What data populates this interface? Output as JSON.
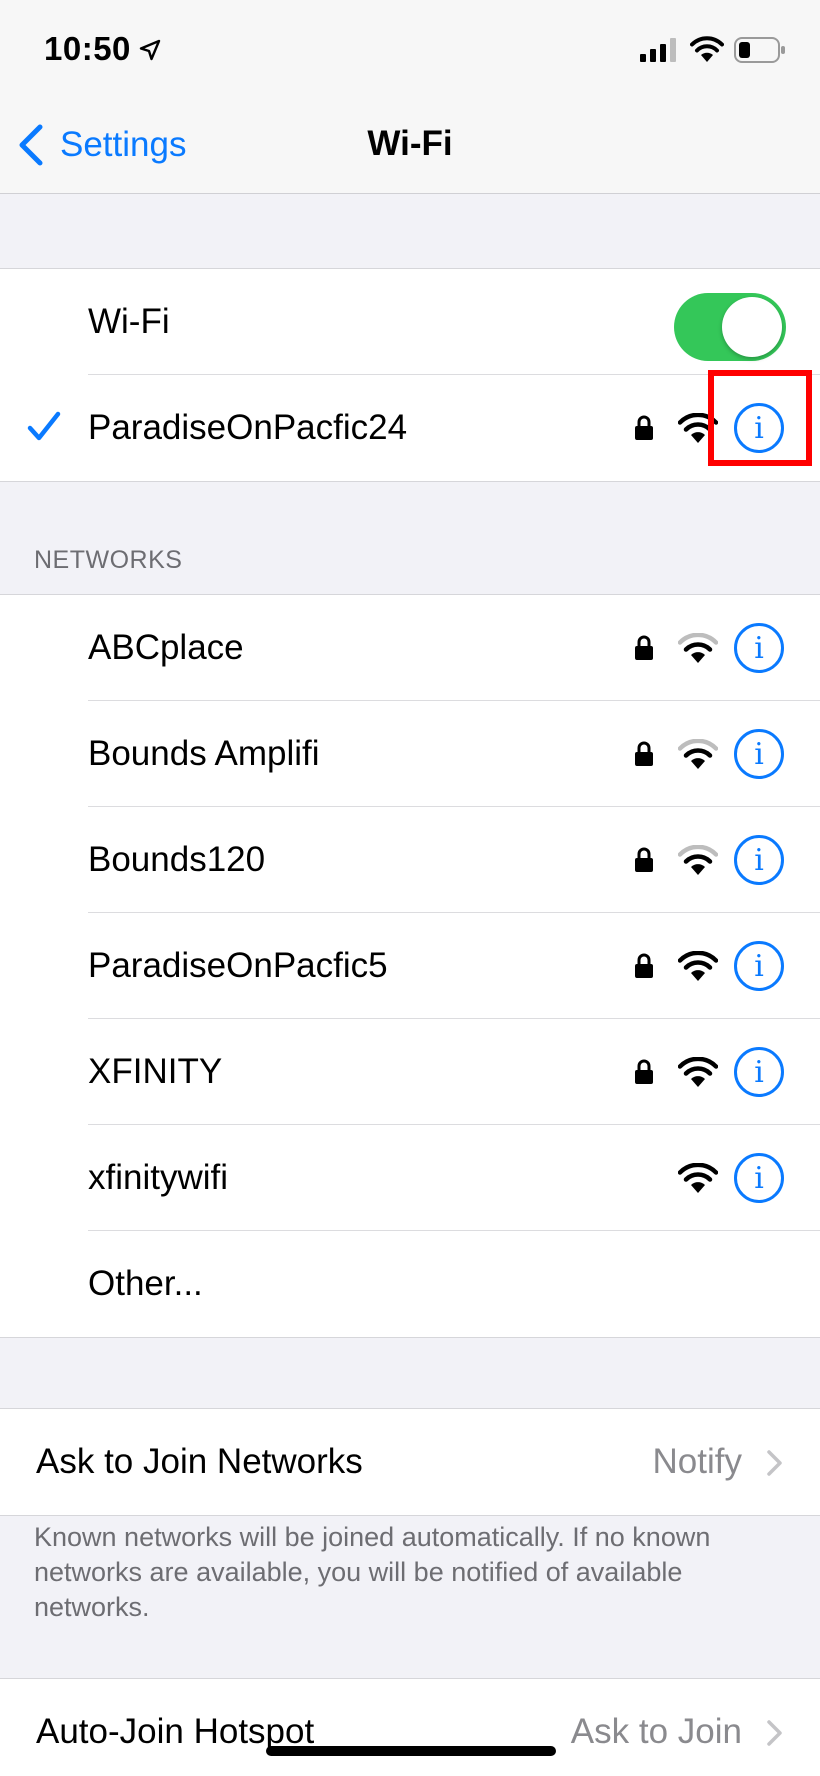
{
  "status_bar": {
    "time": "10:50"
  },
  "nav": {
    "back_label": "Settings",
    "title": "Wi-Fi"
  },
  "wifi_toggle": {
    "label": "Wi-Fi",
    "on": true
  },
  "connected_network": {
    "name": "ParadiseOnPacfic24",
    "locked": true,
    "signal": 3
  },
  "networks_header": "NETWORKS",
  "networks": [
    {
      "name": "ABCplace",
      "locked": true,
      "signal": 2
    },
    {
      "name": "Bounds Amplifi",
      "locked": true,
      "signal": 2
    },
    {
      "name": "Bounds120",
      "locked": true,
      "signal": 2
    },
    {
      "name": "ParadiseOnPacfic5",
      "locked": true,
      "signal": 3
    },
    {
      "name": "XFINITY",
      "locked": true,
      "signal": 3
    },
    {
      "name": "xfinitywifi",
      "locked": false,
      "signal": 3
    }
  ],
  "other_label": "Other...",
  "ask_to_join": {
    "label": "Ask to Join Networks",
    "value": "Notify"
  },
  "footer_text": "Known networks will be joined automatically. If no known networks are available, you will be notified of available networks.",
  "auto_join": {
    "label": "Auto-Join Hotspot",
    "value": "Ask to Join"
  },
  "colors": {
    "accent": "#0a7aff",
    "toggle_on": "#34c759",
    "highlight": "#ff0000"
  }
}
